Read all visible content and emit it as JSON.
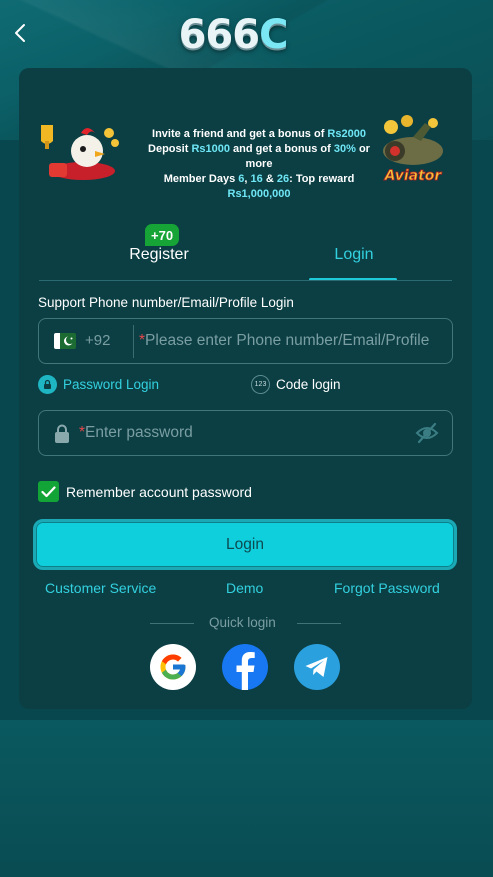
{
  "header": {
    "back_icon": "chevron-left-icon",
    "logo_text": "666",
    "logo_letter": "C"
  },
  "banner": {
    "line1_pre": "Invite a friend and get a bonus of ",
    "line1_amount": "Rs2000",
    "line2_pre": "Deposit ",
    "line2_amount": "Rs1000",
    "line2_mid": " and get a bonus of ",
    "line2_pct": "30%",
    "line2_post": " or more",
    "line3_pre": "Member Days ",
    "line3_d1": "6",
    "line3_sep1": ", ",
    "line3_d2": "16",
    "line3_sep2": " & ",
    "line3_d3": "26",
    "line3_mid": ": Top reward ",
    "line3_amount": "Rs1,000,000",
    "right_badge": "Aviator"
  },
  "tabs": {
    "register_label": "Register",
    "register_badge": "+70",
    "login_label": "Login",
    "active": "Login"
  },
  "form": {
    "account_label": "Support Phone number/Email/Profile Login",
    "country_code": "+92",
    "account_placeholder": "Please enter Phone number/Email/Profile",
    "mode_password": "Password Login",
    "mode_code": "Code login",
    "mode_code_icon_text": "123",
    "password_placeholder": "Enter password",
    "required_mark": "*",
    "remember_label": "Remember account password",
    "remember_checked": true,
    "login_button": "Login"
  },
  "links": {
    "customer_service": "Customer Service",
    "demo": "Demo",
    "forgot_password": "Forgot Password"
  },
  "quick_login": {
    "label": "Quick login",
    "providers": [
      "google-icon",
      "facebook-icon",
      "telegram-icon"
    ]
  },
  "colors": {
    "accent": "#33d1df",
    "button": "#0fcfdd",
    "card": "#0b3f44",
    "background": "#07474d",
    "badge_green": "#17a437",
    "required_red": "#e6484b"
  }
}
